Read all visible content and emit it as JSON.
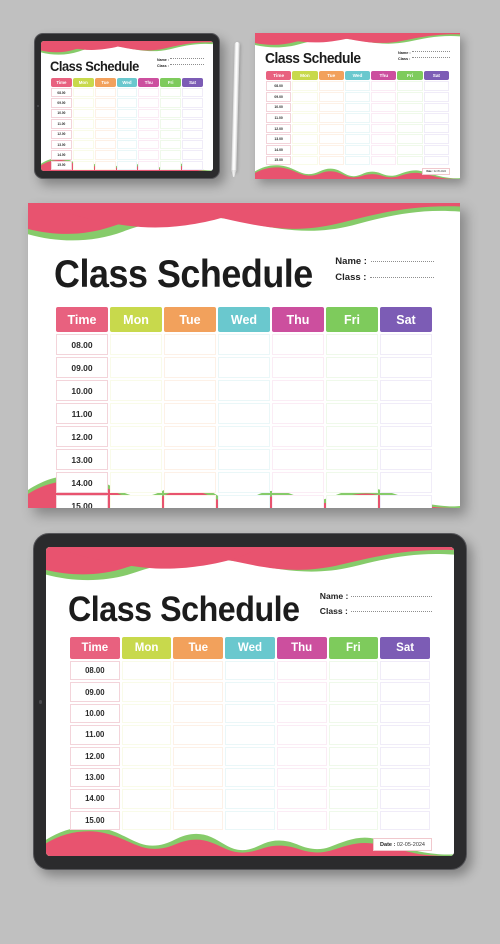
{
  "background_color": "#c0c0c0",
  "schedule": {
    "title": "Class Schedule",
    "fields": [
      {
        "label": "Name :"
      },
      {
        "label": "Class :"
      }
    ],
    "columns": [
      {
        "label": "Time",
        "color": "#e8617f",
        "tint": "#fdeef1"
      },
      {
        "label": "Mon",
        "color": "#c8d94c",
        "tint": "#f9fbe9"
      },
      {
        "label": "Tue",
        "color": "#f2a15c",
        "tint": "#fdf1e7"
      },
      {
        "label": "Wed",
        "color": "#6ac8ce",
        "tint": "#eaf7f8"
      },
      {
        "label": "Thu",
        "color": "#cc4f9e",
        "tint": "#fbecf5"
      },
      {
        "label": "Fri",
        "color": "#7ecb5c",
        "tint": "#eff9ea"
      },
      {
        "label": "Sat",
        "color": "#7c5cb5",
        "tint": "#f0ecf8"
      }
    ],
    "rows": [
      {
        "time": "08.00",
        "cells": [
          "",
          "",
          "",
          "",
          "",
          ""
        ]
      },
      {
        "time": "09.00",
        "cells": [
          "",
          "",
          "",
          "",
          "",
          ""
        ]
      },
      {
        "time": "10.00",
        "cells": [
          "",
          "",
          "",
          "",
          "",
          ""
        ]
      },
      {
        "time": "11.00",
        "cells": [
          "",
          "",
          "",
          "",
          "",
          ""
        ]
      },
      {
        "time": "12.00",
        "cells": [
          "",
          "",
          "",
          "",
          "",
          ""
        ]
      },
      {
        "time": "13.00",
        "cells": [
          "",
          "",
          "",
          "",
          "",
          ""
        ]
      },
      {
        "time": "14.00",
        "cells": [
          "",
          "",
          "",
          "",
          "",
          ""
        ]
      },
      {
        "time": "15.00",
        "cells": [
          "",
          "",
          "",
          "",
          "",
          ""
        ]
      }
    ],
    "date_label": "Date :",
    "date_value": "02-05-2024"
  },
  "decor": {
    "wave_pink": "#e8536f",
    "wave_green": "#86cb6a"
  },
  "mockups": [
    {
      "name": "tablet-small",
      "device": "tablet"
    },
    {
      "name": "paper-small",
      "device": "paper"
    },
    {
      "name": "main-card",
      "device": "paper"
    },
    {
      "name": "tablet-large",
      "device": "tablet"
    }
  ]
}
